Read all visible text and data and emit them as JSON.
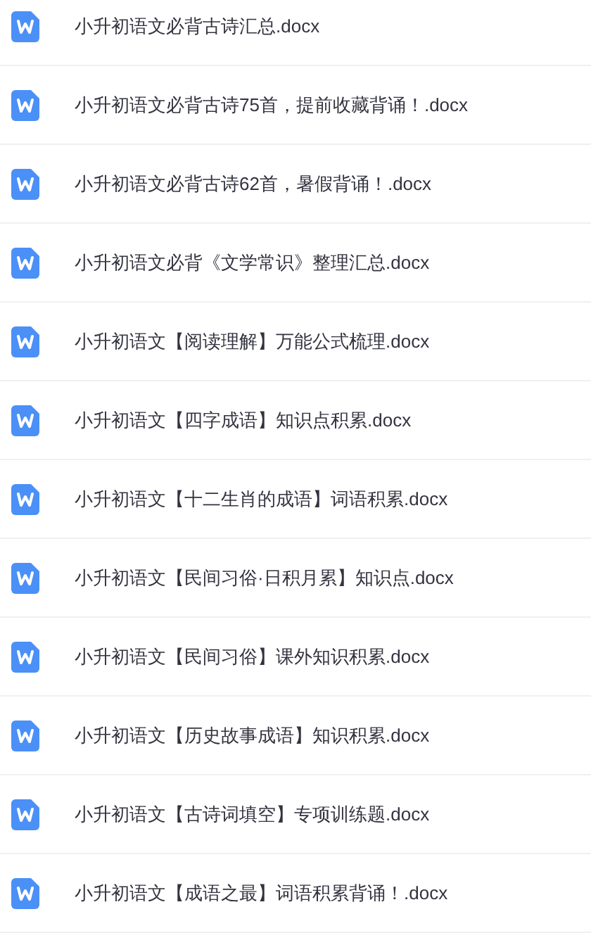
{
  "files": [
    {
      "name": "小升初语文必背古诗汇总.docx"
    },
    {
      "name": "小升初语文必背古诗75首，提前收藏背诵！.docx"
    },
    {
      "name": "小升初语文必背古诗62首，暑假背诵！.docx"
    },
    {
      "name": "小升初语文必背《文学常识》整理汇总.docx"
    },
    {
      "name": "小升初语文【阅读理解】万能公式梳理.docx"
    },
    {
      "name": "小升初语文【四字成语】知识点积累.docx"
    },
    {
      "name": "小升初语文【十二生肖的成语】词语积累.docx"
    },
    {
      "name": "小升初语文【民间习俗·日积月累】知识点.docx"
    },
    {
      "name": "小升初语文【民间习俗】课外知识积累.docx"
    },
    {
      "name": "小升初语文【历史故事成语】知识积累.docx"
    },
    {
      "name": "小升初语文【古诗词填空】专项训练题.docx"
    },
    {
      "name": "小升初语文【成语之最】词语积累背诵！.docx"
    }
  ]
}
